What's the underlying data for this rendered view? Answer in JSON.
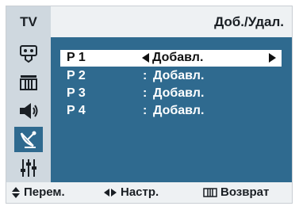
{
  "header": {
    "tab": "TV",
    "title": "Доб./Удал."
  },
  "sidebar": {
    "items": [
      {
        "icon": "input-icon",
        "active": false
      },
      {
        "icon": "channel-icon",
        "active": false
      },
      {
        "icon": "sound-icon",
        "active": false
      },
      {
        "icon": "satellite-icon",
        "active": true
      },
      {
        "icon": "equalizer-icon",
        "active": false
      }
    ]
  },
  "channels": [
    {
      "program": "P 1",
      "value": "Добавл.",
      "selected": true
    },
    {
      "program": "P 2",
      "separator": ":",
      "value": "Добавл.",
      "selected": false
    },
    {
      "program": "P 3",
      "separator": ":",
      "value": "Добавл.",
      "selected": false
    },
    {
      "program": "P 4",
      "separator": ":",
      "value": "Добавл.",
      "selected": false
    }
  ],
  "footer": {
    "move_label": "Перем.",
    "adjust_label": "Настр.",
    "return_label": "Возврат"
  },
  "colors": {
    "panel_blue": "#2f6a8f",
    "sidebar_gray": "#cfd8df",
    "background": "#eef1f3"
  }
}
